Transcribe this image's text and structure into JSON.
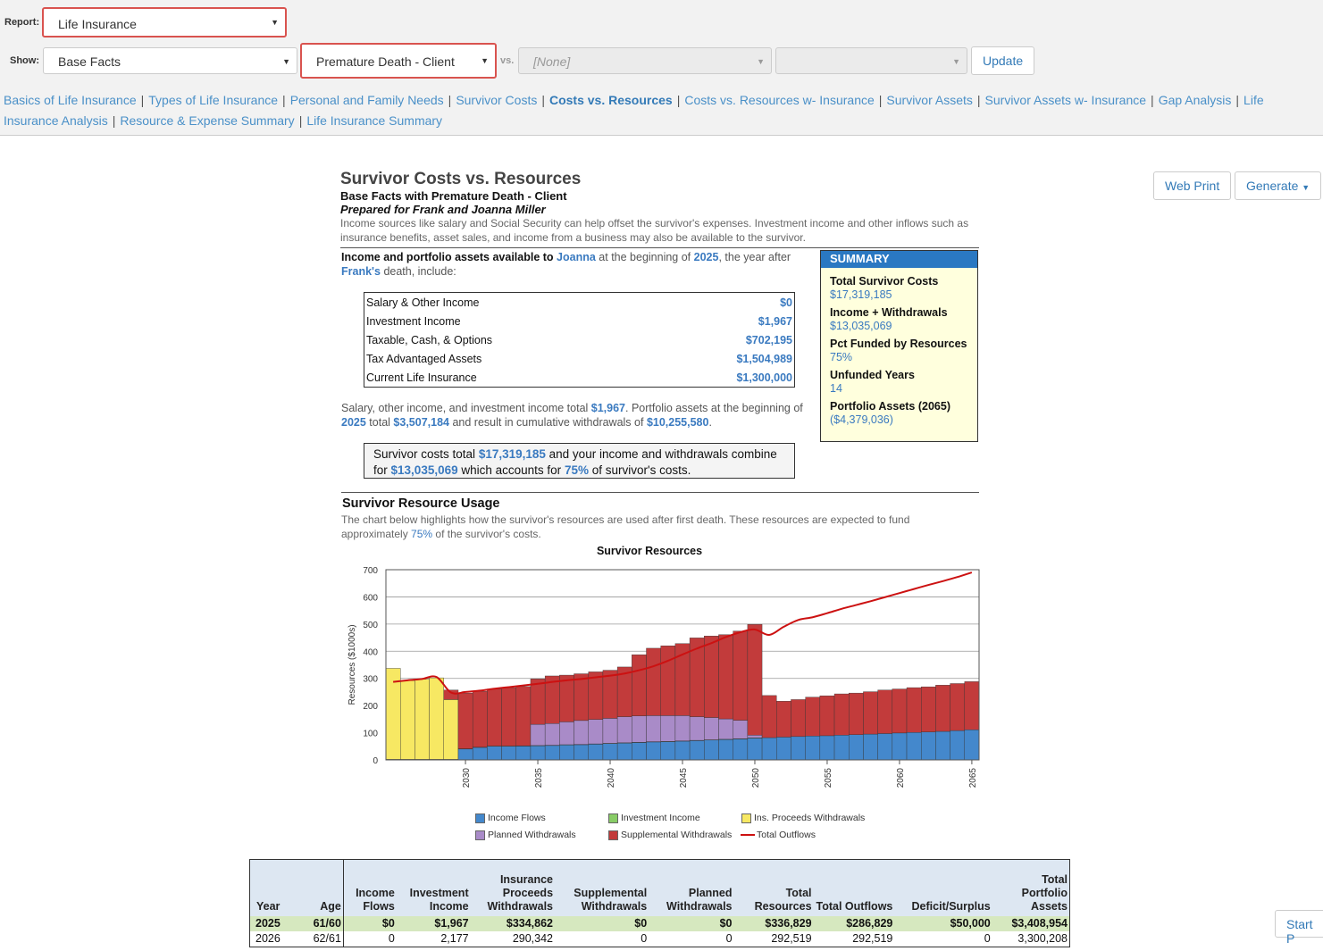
{
  "toolbar": {
    "report_label": "Report:",
    "report_value": "Life Insurance",
    "show_label": "Show:",
    "show_value": "Base Facts",
    "scenario_value": "Premature Death - Client",
    "vs_label": "vs.",
    "vs_value": "[None]",
    "vs2_value": "",
    "update_label": "Update"
  },
  "nav": [
    {
      "label": "Basics of Life Insurance",
      "active": false
    },
    {
      "label": "Types of Life Insurance",
      "active": false
    },
    {
      "label": "Personal and Family Needs",
      "active": false
    },
    {
      "label": "Survivor Costs",
      "active": false
    },
    {
      "label": "Costs vs. Resources",
      "active": true
    },
    {
      "label": "Costs vs. Resources w- Insurance",
      "active": false
    },
    {
      "label": "Survivor Assets",
      "active": false
    },
    {
      "label": "Survivor Assets w- Insurance",
      "active": false
    },
    {
      "label": "Gap Analysis",
      "active": false
    },
    {
      "label": "Life Insurance Analysis",
      "active": false
    },
    {
      "label": "Resource & Expense Summary",
      "active": false
    },
    {
      "label": "Life Insurance Summary",
      "active": false
    }
  ],
  "actions": {
    "web_print": "Web Print",
    "generate": "Generate"
  },
  "report": {
    "title": "Survivor Costs vs. Resources",
    "subtitle": "Base Facts with Premature Death - Client",
    "prepared": "Prepared for Frank and Joanna Miller",
    "description": "Income sources like salary and Social Security can help offset the survivor's expenses. Investment income and other inflows such as insurance benefits, asset sales, and income from a business may also be available to the survivor.",
    "intro_bold": "Income and portfolio assets available to",
    "intro_name": "Joanna",
    "intro_mid": "at the beginning of",
    "intro_year": "2025",
    "intro_after": ", the year after",
    "intro_name2": "Frank's",
    "intro_end": "death, include:",
    "income_rows": [
      {
        "label": "Salary & Other Income",
        "value": "$0"
      },
      {
        "label": "Investment Income",
        "value": "$1,967"
      },
      {
        "label": "Taxable, Cash, & Options",
        "value": "$702,195"
      },
      {
        "label": "Tax Advantaged Assets",
        "value": "$1,504,989"
      },
      {
        "label": "Current Life Insurance",
        "value": "$1,300,000"
      }
    ],
    "para_a": "Salary, other income, and investment income total",
    "para_b": "$1,967",
    "para_c": ". Portfolio assets at the beginning of",
    "para_d": "2025",
    "para_e": "total",
    "para_f": "$3,507,184",
    "para_g": "and result in cumulative withdrawals of",
    "para_h": "$10,255,580",
    "para_i": ".",
    "callout_a": "Survivor costs total",
    "callout_b": "$17,319,185",
    "callout_c": "and your income and withdrawals combine for",
    "callout_d": "$13,035,069",
    "callout_e": "which accounts for",
    "callout_f": "75%",
    "callout_g": "of survivor's costs.",
    "usage_title": "Survivor Resource Usage",
    "usage_a": "The chart below highlights how the survivor's resources are used after first death. These resources are expected to fund approximately",
    "usage_b": "75%",
    "usage_c": "of the survivor's costs."
  },
  "summary": {
    "header": "SUMMARY",
    "items": [
      {
        "label": "Total Survivor Costs",
        "value": "$17,319,185"
      },
      {
        "label": "Income + Withdrawals",
        "value": "$13,035,069"
      },
      {
        "label": "Pct Funded by Resources",
        "value": "75%"
      },
      {
        "label": "Unfunded Years",
        "value": "14"
      },
      {
        "label": "Portfolio Assets (2065)",
        "value": "($4,379,036)"
      }
    ]
  },
  "chart_data": {
    "type": "bar",
    "title": "Survivor Resources",
    "ylabel": "Resources ($1000s)",
    "ylim": [
      0,
      700
    ],
    "yticks": [
      0,
      100,
      200,
      300,
      400,
      500,
      600,
      700
    ],
    "xticks": [
      2030,
      2035,
      2040,
      2045,
      2050,
      2055,
      2060,
      2065
    ],
    "x": [
      2025,
      2026,
      2027,
      2028,
      2029,
      2030,
      2031,
      2032,
      2033,
      2034,
      2035,
      2036,
      2037,
      2038,
      2039,
      2040,
      2041,
      2042,
      2043,
      2044,
      2045,
      2046,
      2047,
      2048,
      2049,
      2050,
      2051,
      2052,
      2053,
      2054,
      2055,
      2056,
      2057,
      2058,
      2059,
      2060,
      2061,
      2062,
      2063,
      2064,
      2065
    ],
    "stacked": true,
    "series": [
      {
        "name": "Income Flows",
        "color": "#4488cc",
        "values": [
          0,
          0,
          0,
          0,
          0,
          40,
          46,
          50,
          50,
          51,
          52,
          53,
          55,
          56,
          58,
          60,
          62,
          64,
          66,
          67,
          69,
          71,
          73,
          75,
          77,
          80,
          82,
          84,
          86,
          88,
          89,
          91,
          93,
          95,
          97,
          99,
          101,
          103,
          105,
          108,
          111
        ]
      },
      {
        "name": "Investment Income",
        "color": "#88cc66",
        "values": [
          2,
          2,
          2,
          2,
          2,
          1,
          1,
          1,
          1,
          1,
          1,
          1,
          1,
          1,
          1,
          1,
          1,
          1,
          1,
          1,
          1,
          1,
          1,
          1,
          1,
          1,
          0,
          0,
          0,
          0,
          0,
          0,
          0,
          0,
          0,
          0,
          0,
          0,
          0,
          0,
          0
        ]
      },
      {
        "name": "Ins. Proceeds Withdrawals",
        "color": "#f7e863",
        "values": [
          335,
          290,
          295,
          300,
          220,
          0,
          0,
          0,
          0,
          0,
          0,
          0,
          0,
          0,
          0,
          0,
          0,
          0,
          0,
          0,
          0,
          0,
          0,
          0,
          0,
          0,
          0,
          0,
          0,
          0,
          0,
          0,
          0,
          0,
          0,
          0,
          0,
          0,
          0,
          0,
          0
        ]
      },
      {
        "name": "Planned Withdrawals",
        "color": "#a98bc8",
        "values": [
          0,
          0,
          0,
          0,
          0,
          0,
          0,
          0,
          0,
          0,
          78,
          80,
          84,
          88,
          90,
          92,
          96,
          97,
          96,
          95,
          93,
          87,
          82,
          75,
          68,
          10,
          0,
          0,
          0,
          0,
          0,
          0,
          0,
          0,
          0,
          0,
          0,
          0,
          0,
          0,
          0
        ]
      },
      {
        "name": "Supplemental Withdrawals",
        "color": "#c23b3b",
        "values": [
          0,
          0,
          0,
          0,
          35,
          205,
          205,
          210,
          215,
          218,
          167,
          175,
          172,
          172,
          175,
          177,
          183,
          225,
          248,
          257,
          265,
          290,
          300,
          310,
          328,
          408,
          155,
          132,
          136,
          143,
          147,
          152,
          153,
          156,
          160,
          162,
          165,
          166,
          170,
          173,
          177
        ]
      }
    ],
    "line": {
      "name": "Total Outflows",
      "color": "#cc1111",
      "values": [
        287,
        293,
        298,
        305,
        248,
        250,
        255,
        262,
        268,
        274,
        280,
        287,
        293,
        298,
        304,
        310,
        318,
        330,
        345,
        365,
        388,
        410,
        430,
        452,
        470,
        480,
        460,
        490,
        515,
        525,
        540,
        556,
        570,
        584,
        599,
        614,
        629,
        644,
        658,
        673,
        690
      ]
    }
  },
  "table": {
    "headers": [
      "Year",
      "Age",
      "Income Flows",
      "Investment Income",
      "Insurance Proceeds Withdrawals",
      "Supplemental Withdrawals",
      "Planned Withdrawals",
      "Total Resources",
      "Total Outflows",
      "Deficit/Surplus",
      "Total Portfolio Assets"
    ],
    "rows": [
      [
        "2025",
        "61/60",
        "$0",
        "$1,967",
        "$334,862",
        "$0",
        "$0",
        "$336,829",
        "$286,829",
        "$50,000",
        "$3,408,954"
      ],
      [
        "2026",
        "62/61",
        "0",
        "2,177",
        "290,342",
        "0",
        "0",
        "292,519",
        "292,519",
        "0",
        "3,300,208"
      ]
    ]
  },
  "start_button": "Start P"
}
